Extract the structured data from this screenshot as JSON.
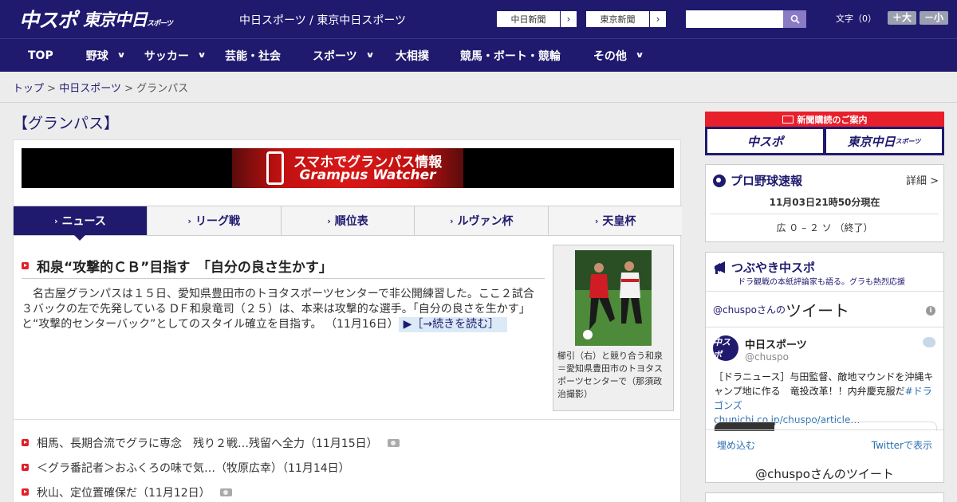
{
  "header": {
    "logo_main": "中スポ",
    "logo_tokyo": "東京中日",
    "logo_tokyo_small": "スポーツ",
    "tagline": "中日スポーツ / 東京中日スポーツ",
    "paper_buttons": [
      {
        "label": "中日新聞",
        "arrow": "›"
      },
      {
        "label": "東京新聞",
        "arrow": "›"
      }
    ],
    "search": {
      "placeholder": "",
      "value": "",
      "icon": "search-icon"
    },
    "font_size": {
      "label": "文字（0）",
      "larger": "＋大",
      "smaller": "－小"
    }
  },
  "nav": {
    "items": [
      {
        "label": "TOP",
        "dropdown": false
      },
      {
        "label": "野球",
        "dropdown": true
      },
      {
        "label": "サッカー",
        "dropdown": true
      },
      {
        "label": "芸能・社会",
        "dropdown": false
      },
      {
        "label": "スポーツ",
        "dropdown": true
      },
      {
        "label": "大相撲",
        "dropdown": false
      },
      {
        "label": "競馬・ボート・競輪",
        "dropdown": false
      },
      {
        "label": "その他",
        "dropdown": true
      }
    ]
  },
  "breadcrumb": {
    "items": [
      {
        "label": "トップ",
        "link": true
      },
      {
        "label": "中日スポーツ",
        "link": true
      },
      {
        "label": "グランパス",
        "link": false
      }
    ],
    "separator": ">"
  },
  "page_title": "【グランパス】",
  "banner": {
    "line1": "スマホでグランパス情報",
    "line2": "Grampus Watcher"
  },
  "tabs": [
    {
      "label": "ニュース",
      "active": true
    },
    {
      "label": "リーグ戦",
      "active": false
    },
    {
      "label": "順位表",
      "active": false
    },
    {
      "label": "ルヴァン杯",
      "active": false
    },
    {
      "label": "天皇杯",
      "active": false
    }
  ],
  "tab_arrow": "›",
  "article": {
    "headline": "和泉“攻撃的ＣＢ”目指す　「自分の良さ生かす」",
    "body": "名古屋グランパスは１５日、愛知県豊田市のトヨタスポーツセンターで非公開練習した。ここ２試合３バックの左で先発している DＦ和泉竜司（２５）は、本来は攻撃的な選手。「自分の良さを生かす」と“攻撃的センターバック”としてのスタイル確立を目指す。",
    "date": "（11月16日）",
    "more": "▶［→続きを読む］",
    "photo_caption": "櫛引（右）と競り合う和泉＝愛知県豊田市のトヨタスポーツセンターで（那須政治撮影）"
  },
  "news_list": [
    {
      "title": "相馬、長期合流でグラに専念　残り２戦…残留へ全力（11月15日）",
      "has_photo": true
    },
    {
      "title": "＜グラ番記者＞おふくろの味で気…（牧原広幸）（11月14日）",
      "has_photo": false
    },
    {
      "title": "秋山、定位置確保だ（11月12日）",
      "has_photo": true
    }
  ],
  "sidebar": {
    "ad": {
      "head": "新聞購読のご案内",
      "buttons": [
        "中スポ",
        "東京中日"
      ],
      "button_small": "スポーツ"
    },
    "baseball": {
      "title": "プロ野球速報",
      "detail": "詳細 >",
      "time": "11月03日21時50分現在",
      "score": "広 ０ – ２ ソ （終了）"
    },
    "twitter": {
      "title": "つぶやき中スポ",
      "subtitle": "ドラ観戦の本紙評論家も語る。グラも熱烈応援",
      "head_account": "@chuspoさんの",
      "head_word": "ツイート",
      "info": "i",
      "user_name": "中日スポーツ",
      "user_handle": "@chuspo",
      "avatar_text": "中スポ",
      "tweet_text": "［ドラニュース］与田監督、敵地マウンドを沖縄キャンプ地に作る　竜投改革！！内弁慶克服だ",
      "tweet_link": "#ドラゴンズ",
      "tweet_url": "chunichi.co.jp/chuspo/article…",
      "embed": "埋め込む",
      "view_on": "Twitterで表示",
      "footer": "@chuspoさんのツイート"
    }
  },
  "colors": {
    "brand_navy": "#1f1a6e",
    "accent_red": "#e0202a",
    "link_blue": "#2a6fb3"
  }
}
